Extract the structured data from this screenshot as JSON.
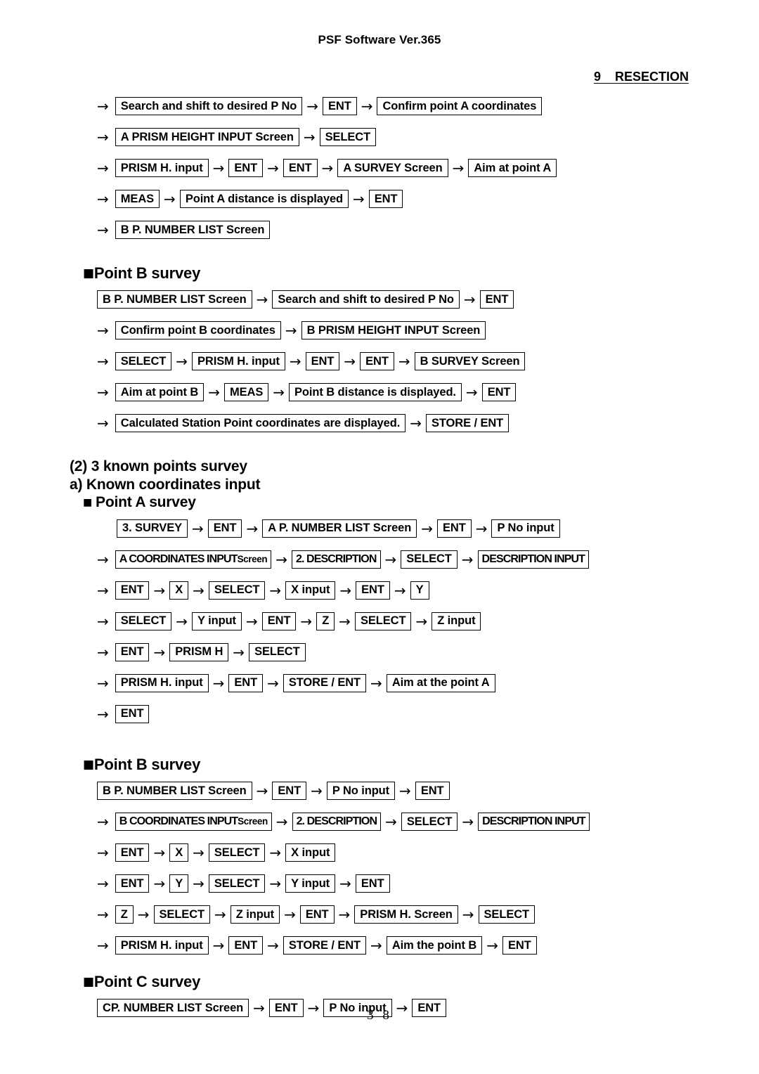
{
  "header": {
    "software_title": "PSF Software Ver.365",
    "chapter": "9    RESECTION"
  },
  "page_number": "3 8",
  "symbols": {
    "arrow": "→",
    "bullet": "■"
  },
  "sections": [
    {
      "id": "point-a-survey-continued",
      "heading": null,
      "rows": [
        {
          "lead_arrow": true,
          "items": [
            "Search and shift to desired P No",
            "ENT",
            "Confirm point A coordinates"
          ]
        },
        {
          "lead_arrow": true,
          "items": [
            "A PRISM HEIGHT INPUT Screen",
            "SELECT"
          ]
        },
        {
          "lead_arrow": true,
          "items": [
            "PRISM H. input",
            "ENT",
            "ENT",
            "A SURVEY Screen",
            "Aim at point A"
          ]
        },
        {
          "lead_arrow": true,
          "items": [
            "MEAS",
            "Point A distance is displayed",
            "ENT"
          ]
        },
        {
          "lead_arrow": true,
          "items": [
            "B P. NUMBER LIST Screen"
          ]
        }
      ]
    },
    {
      "id": "point-b-survey-1",
      "heading": "Point B survey",
      "heading_style": "square",
      "rows": [
        {
          "lead_arrow": false,
          "items": [
            "B P. NUMBER LIST Screen",
            "Search and shift to desired P No",
            "ENT"
          ]
        },
        {
          "lead_arrow": true,
          "items": [
            "Confirm point B coordinates",
            "B PRISM HEIGHT INPUT Screen"
          ]
        },
        {
          "lead_arrow": true,
          "items": [
            "SELECT",
            "PRISM H. input",
            "ENT",
            "ENT",
            "B SURVEY Screen"
          ]
        },
        {
          "lead_arrow": true,
          "items": [
            "Aim at point B",
            "MEAS",
            "Point B distance is displayed.",
            "ENT"
          ]
        },
        {
          "lead_arrow": true,
          "items": [
            "Calculated Station Point coordinates are displayed.",
            "STORE / ENT"
          ]
        }
      ]
    }
  ],
  "known_points_section": {
    "title": "(2) 3 known points survey",
    "subtitle": "a) Known coordinates input",
    "point_a": {
      "heading": "Point A survey",
      "rows": [
        {
          "lead_arrow": false,
          "items": [
            "3. SURVEY",
            "ENT",
            "A P. NUMBER LIST Screen",
            "ENT",
            "P No input"
          ]
        },
        {
          "lead_arrow": true,
          "items": [
            {
              "text": "A COORDINATES INPUT Screen",
              "style": "narrow",
              "parts": [
                {
                  "t": "A COORDINATES INPUT ",
                  "sm": false
                },
                {
                  "t": "Screen",
                  "sm": true
                }
              ]
            },
            {
              "text": "2. DESCRIPTION",
              "style": "narrow"
            },
            {
              "text": "SELECT"
            },
            {
              "text": "DESCRIPTION INPUT",
              "style": "narrow"
            }
          ]
        },
        {
          "lead_arrow": true,
          "items": [
            "ENT",
            "X",
            "SELECT",
            "X input",
            "ENT",
            "Y"
          ]
        },
        {
          "lead_arrow": true,
          "items": [
            "SELECT",
            "Y input",
            "ENT",
            "Z",
            "SELECT",
            "Z input"
          ]
        },
        {
          "lead_arrow": true,
          "items": [
            "ENT",
            "PRISM H",
            "SELECT"
          ]
        },
        {
          "lead_arrow": true,
          "items": [
            "PRISM H. input",
            "ENT",
            "STORE / ENT",
            "Aim at the point A"
          ]
        },
        {
          "lead_arrow": true,
          "items": [
            "ENT"
          ]
        }
      ]
    },
    "point_b": {
      "heading": "Point B survey",
      "rows": [
        {
          "lead_arrow": false,
          "items": [
            "B P. NUMBER LIST Screen",
            "ENT",
            "P No input",
            "ENT"
          ]
        },
        {
          "lead_arrow": true,
          "items": [
            {
              "text": "B COORDINATES INPUT Screen",
              "style": "narrow",
              "parts": [
                {
                  "t": "B COORDINATES INPUT ",
                  "sm": false
                },
                {
                  "t": "Screen",
                  "sm": true
                }
              ]
            },
            {
              "text": "2. DESCRIPTION",
              "style": "narrow"
            },
            {
              "text": "SELECT"
            },
            {
              "text": "DESCRIPTION INPUT",
              "style": "narrow"
            }
          ]
        },
        {
          "lead_arrow": true,
          "items": [
            "ENT",
            "X",
            "SELECT",
            "X input"
          ]
        },
        {
          "lead_arrow": true,
          "items": [
            "ENT",
            "Y",
            "SELECT",
            "Y input",
            "ENT"
          ]
        },
        {
          "lead_arrow": true,
          "items": [
            "Z",
            "SELECT",
            "Z input",
            "ENT",
            "PRISM H. Screen",
            "SELECT"
          ]
        },
        {
          "lead_arrow": true,
          "items": [
            "PRISM H. input",
            "ENT",
            "STORE / ENT",
            "Aim the point B",
            "ENT"
          ]
        }
      ]
    },
    "point_c": {
      "heading": "Point C survey",
      "rows": [
        {
          "lead_arrow": false,
          "items": [
            "CP. NUMBER LIST Screen",
            "ENT",
            "P No input",
            "ENT"
          ]
        }
      ]
    }
  }
}
